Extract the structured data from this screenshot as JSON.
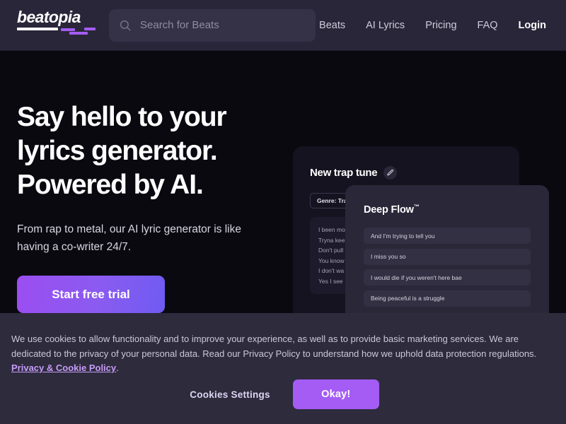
{
  "colors": {
    "header_bg": "#292639",
    "page_bg": "#0a0910",
    "accent_purple": "#a45cf5",
    "cta_gradient_from": "#9b4ef0",
    "cta_gradient_to": "#6f5bf2",
    "cookie_bg": "#2e2b3d",
    "cookie_link": "#c79cf8"
  },
  "header": {
    "logo": {
      "text": "beatopia",
      "icon": "beatopia-logo"
    },
    "search": {
      "icon": "search-icon",
      "placeholder": "Search for Beats",
      "value": ""
    },
    "nav": [
      {
        "label": "Beats",
        "strong": false
      },
      {
        "label": "AI Lyrics",
        "strong": false
      },
      {
        "label": "Pricing",
        "strong": false
      },
      {
        "label": "FAQ",
        "strong": false
      },
      {
        "label": "Login",
        "strong": true
      }
    ]
  },
  "hero": {
    "headline_line1": "Say hello to your",
    "headline_line2": "lyrics generator.",
    "headline_line3": "Powered by AI.",
    "subhead": "From rap to metal, our AI lyric generator is like having a co-writer 24/7.",
    "cta_label": "Start free trial"
  },
  "mockup": {
    "back_card": {
      "title": "New trap tune",
      "edit_icon": "pencil-icon",
      "chip_label": "Genre: Trap",
      "lyric_lines": [
        "I been mo",
        "Tryna kee",
        "Don't pull",
        "You know",
        "I don't wa",
        "Yes I see"
      ]
    },
    "front_card": {
      "title": "Deep Flow",
      "title_sup": "™",
      "suggestions": [
        "And I'm trying to tell you",
        "I miss you so",
        "I would die if you weren't here bae",
        "Being peaceful is a struggle"
      ]
    }
  },
  "cookie_banner": {
    "body": "We use cookies to allow functionality and to improve your experience, as well as to provide basic marketing services. We are dedicated to the privacy of your personal data. Read our Privacy Policy to understand how we uphold data protection regulations. ",
    "link_label": "Privacy & Cookie Policy",
    "trailing": ".",
    "settings_label": "Cookies Settings",
    "accept_label": "Okay!"
  }
}
